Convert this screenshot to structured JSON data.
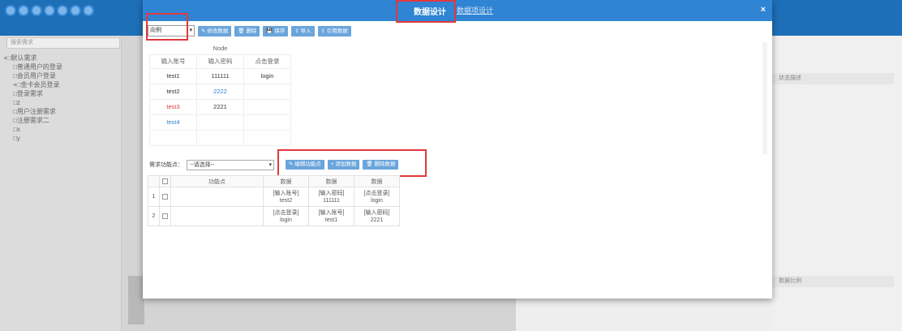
{
  "app": {
    "search_placeholder": "搜索需求",
    "tree": [
      {
        "label": "默认需求",
        "level": 0
      },
      {
        "label": "普通用户的登录",
        "level": 1
      },
      {
        "label": "会员用户登录",
        "level": 1
      },
      {
        "label": "金卡会员登录",
        "level": 1
      },
      {
        "label": "登录需求",
        "level": 1
      },
      {
        "label": "z",
        "level": 1
      },
      {
        "label": "用户注册需求",
        "level": 1
      },
      {
        "label": "注册需求二",
        "level": 1
      },
      {
        "label": "x",
        "level": 1
      },
      {
        "label": "y",
        "level": 1
      }
    ],
    "right_col_head": "状态描述",
    "right_col_foot": "数据比例"
  },
  "modal": {
    "tabs": {
      "active": "数据设计",
      "inactive": "数据项设计"
    },
    "close": "×",
    "toolbar": {
      "select_value": "向例",
      "buttons": [
        "修改数据",
        "删除",
        "保存",
        "导入",
        "引用数据"
      ]
    },
    "grid": {
      "node_header": "Node",
      "headers": [
        "输入账号",
        "输入密码",
        "点击登录"
      ],
      "rows": [
        {
          "account": "test1",
          "password": "111111",
          "click": "login",
          "acc_color": "#333",
          "pwd_color": "#333"
        },
        {
          "account": "test2",
          "password": "2222",
          "click": "",
          "acc_color": "#333",
          "pwd_color": "#2f84d4"
        },
        {
          "account": "test3",
          "password": "2221",
          "click": "",
          "acc_color": "#e0393e",
          "pwd_color": "#333"
        },
        {
          "account": "test4",
          "password": "",
          "click": "",
          "acc_color": "#2f84d4",
          "pwd_color": "#333"
        }
      ]
    },
    "requirement": {
      "label": "需求功能点：",
      "select_value": "--请选择--",
      "buttons": [
        "编辑功能点",
        "添加数据",
        "删除数据"
      ]
    },
    "req_table": {
      "headers": [
        "",
        "",
        "功能点",
        "数据",
        "数据",
        "数据"
      ],
      "rows": [
        {
          "index": "1",
          "cells": [
            [
              "[输入账号]",
              "test2"
            ],
            [
              "[输入密码]",
              "111111"
            ],
            [
              "[点击登录]",
              "login"
            ]
          ]
        },
        {
          "index": "2",
          "cells": [
            [
              "[点击登录]",
              "login"
            ],
            [
              "[输入账号]",
              "test1"
            ],
            [
              "[输入密码]",
              "2221"
            ]
          ]
        }
      ]
    }
  }
}
